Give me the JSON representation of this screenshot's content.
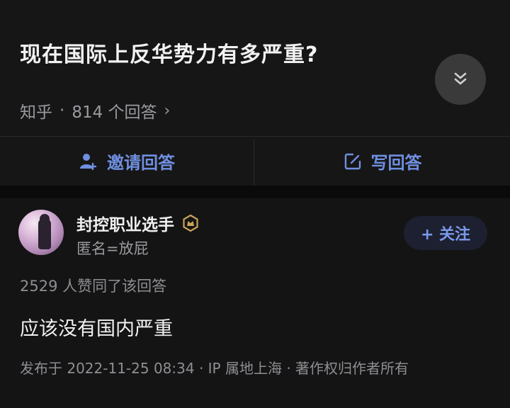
{
  "question": {
    "title": "现在国际上反华势力有多严重?",
    "source": "知乎",
    "separator": "·",
    "answer_count": "814 个回答",
    "chevron": "›"
  },
  "actions": {
    "invite_label": "邀请回答",
    "write_label": "写回答"
  },
  "answer": {
    "author_name": "封控职业选手",
    "author_bio": "匿名=放屁",
    "follow_label": "+ 关注",
    "likes_text": "2529 人赞同了该回答",
    "content": "应该没有国内严重",
    "footer": "发布于 2022-11-25 08:34 · IP 属地上海 · 著作权归作者所有"
  },
  "icons": {
    "collapse": "double-chevron-down-icon",
    "invite": "add-user-icon",
    "write": "edit-icon",
    "badge": "verified-badge-icon"
  },
  "colors": {
    "background": "#121212",
    "accent": "#6f8fe0",
    "muted_text": "#9a9aa0"
  }
}
